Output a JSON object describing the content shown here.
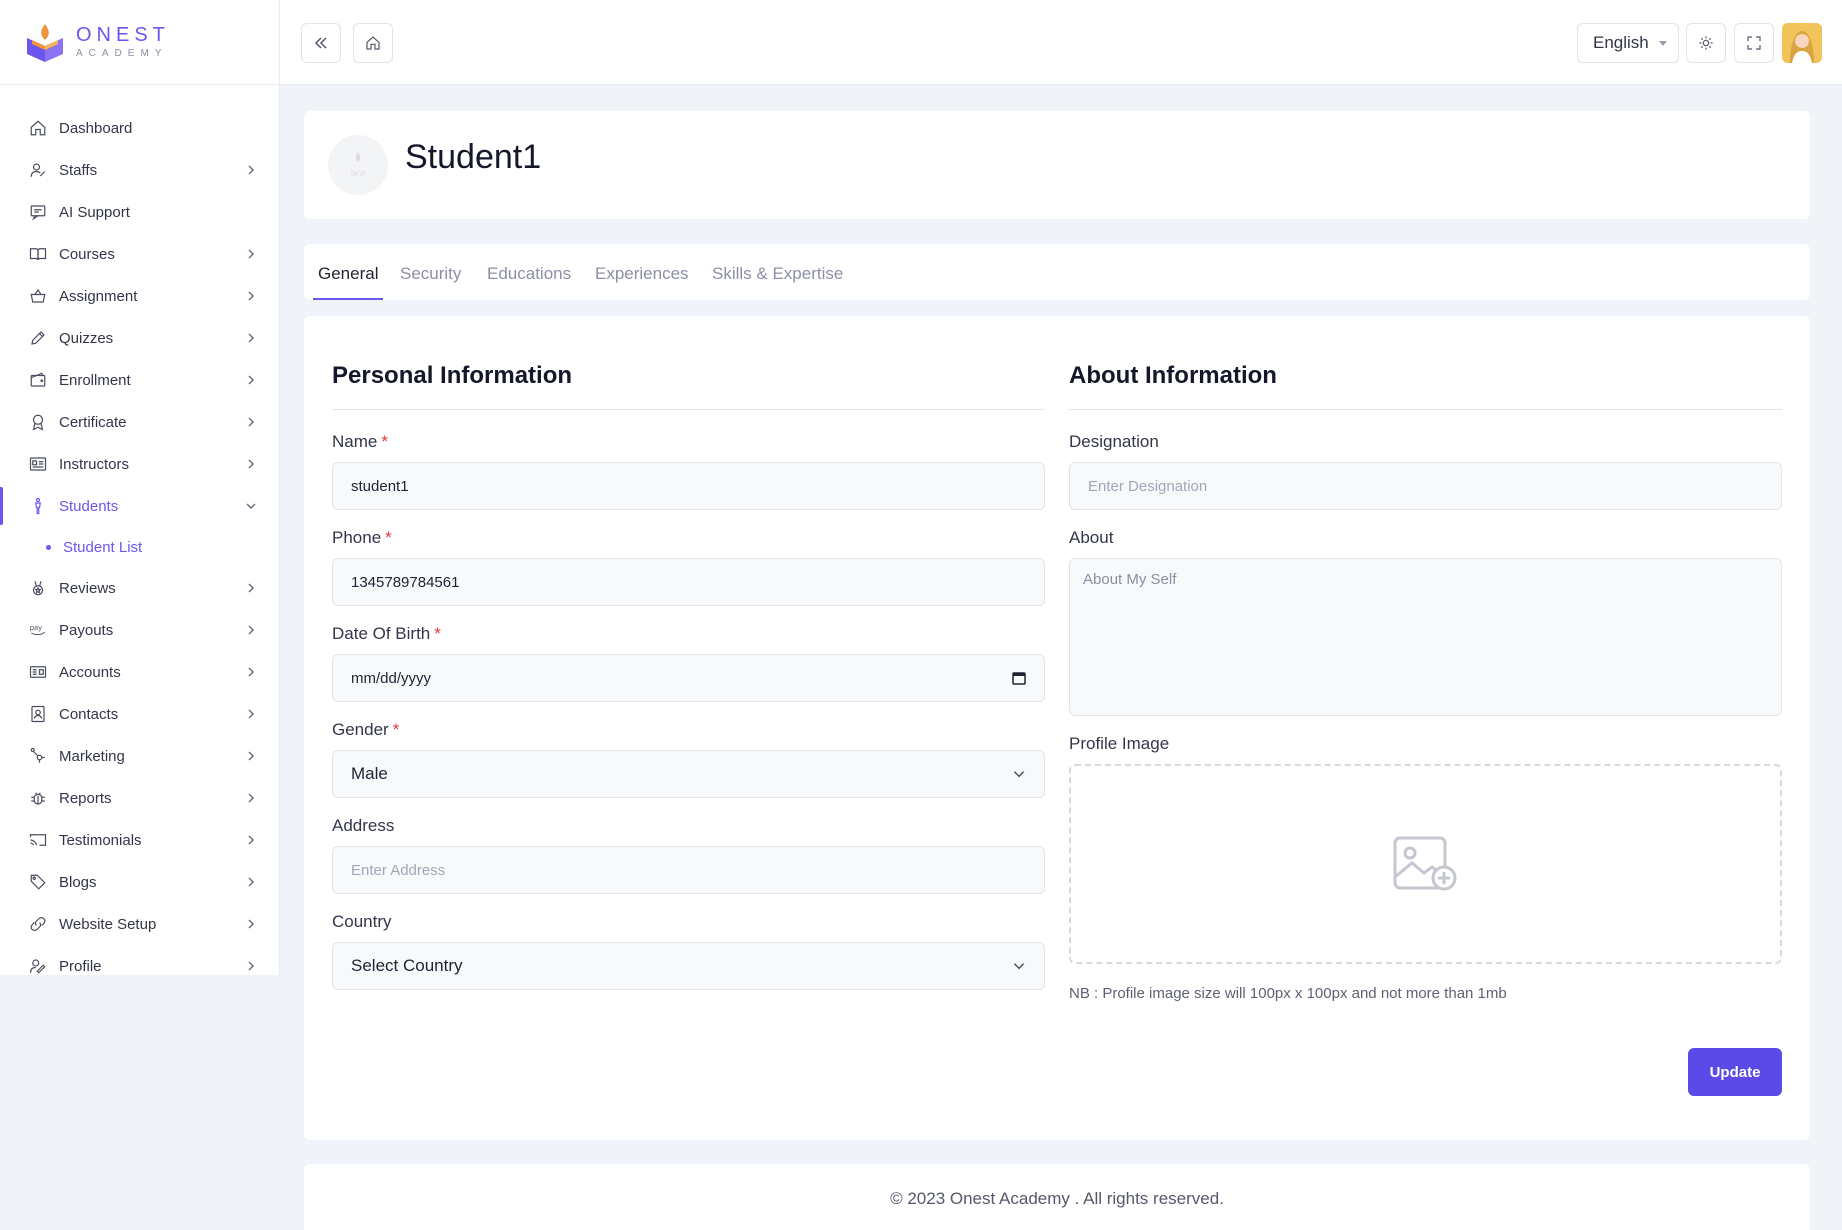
{
  "brand": {
    "name": "ONEST",
    "tagline": "ACADEMY"
  },
  "sidebar": {
    "items": [
      {
        "label": "Dashboard",
        "icon": "home-icon"
      },
      {
        "label": "Staffs",
        "icon": "user-icon"
      },
      {
        "label": "AI Support",
        "icon": "message-icon"
      },
      {
        "label": "Courses",
        "icon": "book-icon"
      },
      {
        "label": "Assignment",
        "icon": "basket-icon"
      },
      {
        "label": "Quizzes",
        "icon": "pen-icon"
      },
      {
        "label": "Enrollment",
        "icon": "wallet-icon"
      },
      {
        "label": "Certificate",
        "icon": "award-icon"
      },
      {
        "label": "Instructors",
        "icon": "id-card-icon"
      },
      {
        "label": "Students",
        "icon": "student-icon"
      },
      {
        "label": "Reviews",
        "icon": "medal-icon"
      },
      {
        "label": "Payouts",
        "icon": "pay-icon"
      },
      {
        "label": "Accounts",
        "icon": "accounts-icon"
      },
      {
        "label": "Contacts",
        "icon": "contacts-icon"
      },
      {
        "label": "Marketing",
        "icon": "hub-icon"
      },
      {
        "label": "Reports",
        "icon": "bug-icon"
      },
      {
        "label": "Testimonials",
        "icon": "cast-icon"
      },
      {
        "label": "Blogs",
        "icon": "tag-icon"
      },
      {
        "label": "Website Setup",
        "icon": "link-icon"
      },
      {
        "label": "Profile",
        "icon": "profile-icon"
      }
    ],
    "sub_item": "Student List"
  },
  "topbar": {
    "language": "English"
  },
  "header": {
    "title": "Student1",
    "avatar_text": "SKIP"
  },
  "tabs": [
    "General",
    "Security",
    "Educations",
    "Experiences",
    "Skills & Expertise"
  ],
  "personal": {
    "title": "Personal Information",
    "name_label": "Name",
    "name_value": "student1",
    "phone_label": "Phone",
    "phone_value": "1345789784561",
    "dob_label": "Date Of Birth",
    "dob_value": "mm/dd/yyyy",
    "gender_label": "Gender",
    "gender_value": "Male",
    "address_label": "Address",
    "address_placeholder": "Enter Address",
    "country_label": "Country",
    "country_value": "Select Country",
    "required_mark": "*"
  },
  "about": {
    "title": "About Information",
    "designation_label": "Designation",
    "designation_placeholder": "Enter Designation",
    "about_label": "About",
    "about_placeholder": "About My Self",
    "image_label": "Profile Image",
    "note": "NB : Profile image size will 100px x 100px and not more than 1mb"
  },
  "actions": {
    "update": "Update"
  },
  "footer": {
    "text": "© 2023 Onest Academy . All rights reserved."
  },
  "colors": {
    "accent": "#6b57f0",
    "button": "#5b49e8",
    "required": "#e53535"
  }
}
